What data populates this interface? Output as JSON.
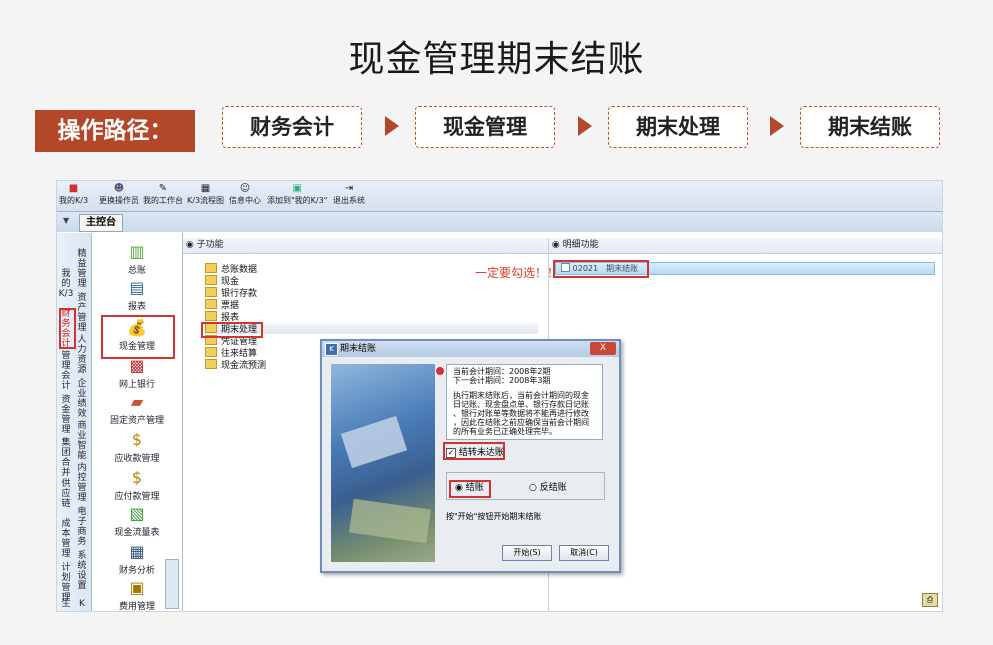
{
  "slide": {
    "title": "现金管理期末结账",
    "path_label": "操作路径：",
    "path_steps": [
      "财务会计",
      "现金管理",
      "期末处理",
      "期末结账"
    ]
  },
  "app": {
    "toolbar": [
      "我的K/3",
      "更换操作员",
      "我的工作台",
      "K/3流程图",
      "信息中心",
      "添加到\"我的K/3\"",
      "退出系统"
    ],
    "tab": "主控台",
    "vertical_tabs": [
      "我的K/3",
      "财务会计",
      "管理会计",
      "资金管理",
      "集团合并",
      "供应链",
      "成本管理",
      "计划管理",
      "生",
      "精益管理",
      "资产管理",
      "人力资源",
      "企业绩效",
      "商业智能",
      "内控管理",
      "电子商务",
      "系统设置",
      "K"
    ],
    "nav_items": [
      "总账",
      "报表",
      "现金管理",
      "网上银行",
      "固定资产管理",
      "应收款管理",
      "应付款管理",
      "现金流量表",
      "财务分析",
      "费用管理"
    ],
    "sub_pane_title": "子功能",
    "sub_items": [
      "总账数据",
      "现金",
      "银行存款",
      "票据",
      "报表",
      "期末处理",
      "凭证管理",
      "往来结算",
      "现金流预测"
    ],
    "detail_pane_title": "明细功能",
    "detail_item": "02021　期末结账"
  },
  "dialog": {
    "title": "期末结账",
    "close_label": "X",
    "info_lines": [
      "当前会计期间：2008年2期",
      "下一会计期间：2008年3期",
      "",
      "执行期末结账后，当前会计期间的现金",
      "日记账、现金盘点单、银行存款日记账",
      "、银行对账单等数据将不能再进行修改",
      "，因此在结账之前应确保当前会计期间",
      "的所有业务已正确处理完毕。"
    ],
    "checkbox_label": "结转未达账",
    "radio_close": "结账",
    "radio_reverse": "反结账",
    "hint": "按\"开始\"按钮开始期末结账",
    "start_button": "开始(S)",
    "cancel_button": "取消(C)"
  },
  "annotation": "一定要勾选！！"
}
